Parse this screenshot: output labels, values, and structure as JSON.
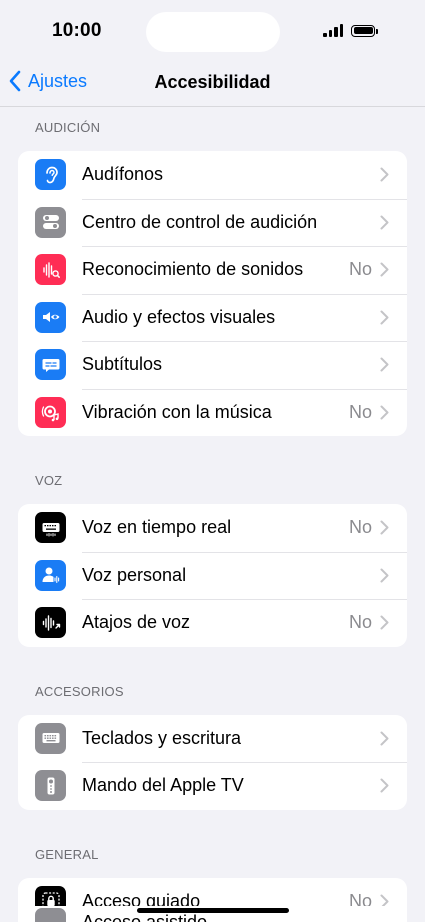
{
  "status_bar": {
    "time": "10:00"
  },
  "nav": {
    "back_label": "Ajustes",
    "title": "Accesibilidad"
  },
  "colors": {
    "accent": "#0a7aff",
    "blue_icon": "#1a7cf5",
    "gray_icon": "#8e8e93",
    "pink_icon": "#ff2d55",
    "black_icon": "#000000"
  },
  "sections": [
    {
      "header": "AUDICIÓN",
      "items": [
        {
          "label": "Audífonos",
          "value": "",
          "icon": "ear-icon",
          "color": "#1a7cf5"
        },
        {
          "label": "Centro de control de audición",
          "value": "",
          "icon": "toggle-switch-icon",
          "color": "#8e8e93"
        },
        {
          "label": "Reconocimiento de sonidos",
          "value": "No",
          "icon": "sound-waves-search-icon",
          "color": "#ff2d55"
        },
        {
          "label": "Audio y efectos visuales",
          "value": "",
          "icon": "speaker-eye-icon",
          "color": "#1a7cf5"
        },
        {
          "label": "Subtítulos",
          "value": "",
          "icon": "speech-bubble-icon",
          "color": "#1a7cf5"
        },
        {
          "label": "Vibración con la música",
          "value": "No",
          "icon": "vibration-music-icon",
          "color": "#ff2d55"
        }
      ]
    },
    {
      "header": "VOZ",
      "items": [
        {
          "label": "Voz en tiempo real",
          "value": "No",
          "icon": "keyboard-wave-icon",
          "color": "#000000"
        },
        {
          "label": "Voz personal",
          "value": "",
          "icon": "person-wave-icon",
          "color": "#1a7cf5"
        },
        {
          "label": "Atajos de voz",
          "value": "No",
          "icon": "waveform-arrow-icon",
          "color": "#000000"
        }
      ]
    },
    {
      "header": "ACCESORIOS",
      "items": [
        {
          "label": "Teclados y escritura",
          "value": "",
          "icon": "keyboard-icon",
          "color": "#8e8e93"
        },
        {
          "label": "Mando del Apple TV",
          "value": "",
          "icon": "remote-icon",
          "color": "#8e8e93"
        }
      ]
    },
    {
      "header": "GENERAL",
      "items": [
        {
          "label": "Acceso guiado",
          "value": "No",
          "icon": "lock-frame-icon",
          "color": "#000000"
        }
      ]
    }
  ],
  "partial_row": {
    "label": "Acceso asistido"
  }
}
